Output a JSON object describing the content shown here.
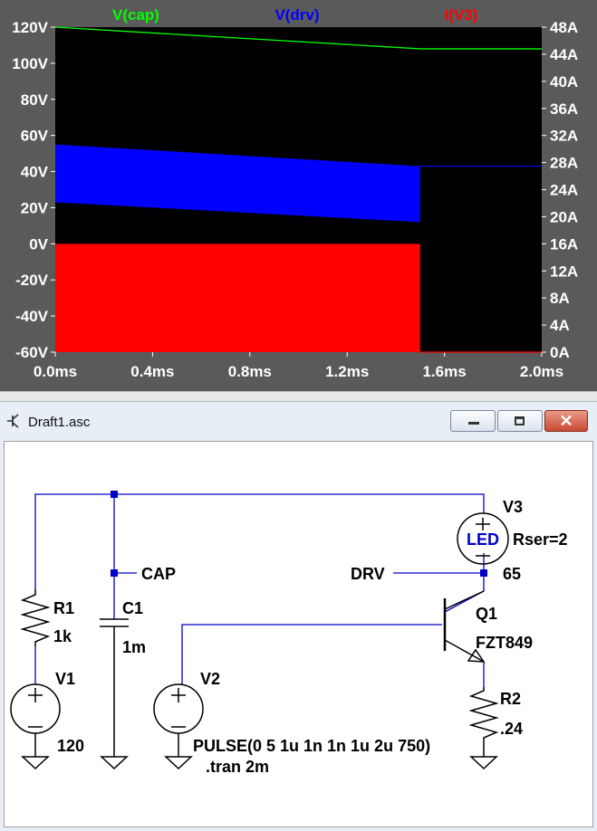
{
  "plot": {
    "traces": [
      {
        "label": "V(cap)",
        "color": "#00ff00"
      },
      {
        "label": "V(drv)",
        "color": "#0000ff"
      },
      {
        "label": "I(V3)",
        "color": "#ff0000"
      }
    ],
    "left_axis_ticks": [
      "120V",
      "100V",
      "80V",
      "60V",
      "40V",
      "20V",
      "0V",
      "-20V",
      "-40V",
      "-60V"
    ],
    "right_axis_ticks": [
      "48A",
      "44A",
      "40A",
      "36A",
      "32A",
      "28A",
      "24A",
      "20A",
      "16A",
      "12A",
      "8A",
      "4A",
      "0A"
    ],
    "x_axis_ticks": [
      "0.0ms",
      "0.4ms",
      "0.8ms",
      "1.2ms",
      "1.6ms",
      "2.0ms"
    ],
    "background": "#000000",
    "axis_text_color": "#ffffff"
  },
  "chart_data": {
    "type": "line",
    "x_unit": "ms",
    "xlim": [
      0,
      2.0
    ],
    "ylim_left": [
      -60,
      120
    ],
    "ylim_right": [
      0,
      48
    ],
    "series": [
      {
        "name": "V(cap)",
        "axis": "left",
        "color": "#00ff00",
        "points": [
          [
            0,
            120
          ],
          [
            1.5,
            108
          ],
          [
            2.0,
            108
          ]
        ]
      },
      {
        "name": "V(drv)",
        "axis": "left",
        "color": "#0000ff",
        "band": true,
        "switching_end": 1.5,
        "upper": [
          [
            0,
            55
          ],
          [
            1.5,
            43
          ]
        ],
        "lower": [
          [
            0,
            23
          ],
          [
            1.5,
            12
          ]
        ],
        "after": 43
      },
      {
        "name": "I(V3)",
        "axis": "right",
        "color": "#ff0000",
        "band": true,
        "switching_end": 1.5,
        "upper": [
          [
            0,
            16
          ],
          [
            1.5,
            16
          ]
        ],
        "lower": [
          [
            0,
            0
          ],
          [
            1.5,
            0
          ]
        ],
        "after": 0
      }
    ]
  },
  "window": {
    "title": "Draft1.asc",
    "icon": "transistor-icon",
    "close_glyph": "✕"
  },
  "schematic": {
    "wire_color": "#0000c8",
    "labels": {
      "r1_name": "R1",
      "r1_value": "1k",
      "c1_name": "C1",
      "c1_value": "1m",
      "v1_name": "V1",
      "v1_value": "120",
      "v2_name": "V2",
      "v2_value": "PULSE(0 5 1u 1n 1n 1u 2u 750)",
      "v3_name": "V3",
      "v3_value": "Rser=2",
      "v3_current": "65",
      "v3_inner": "LED",
      "q1_name": "Q1",
      "q1_model": "FZT849",
      "r2_name": "R2",
      "r2_value": ".24",
      "cap_net": "CAP",
      "drv_net": "DRV",
      "directive": ".tran 2m"
    }
  }
}
